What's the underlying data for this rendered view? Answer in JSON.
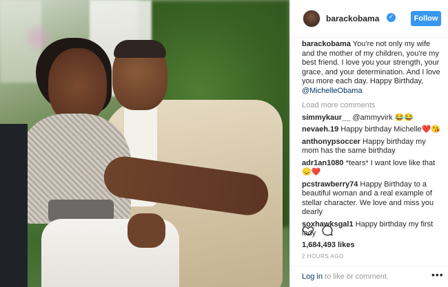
{
  "post": {
    "username": "barackobama",
    "follow_label": "Follow",
    "verified_glyph": "✓",
    "caption_user": "barackobama",
    "caption_text": " You're not only my wife and the mother of my children, you're my best friend. I love you your strength, your grace, and your determination. And I love you more each day. Happy Birthday, ",
    "caption_mention": "@MichelleObama",
    "load_more": "Load more comments",
    "comments": [
      {
        "user": "simmykaur__",
        "text": " @ammyvirk 😂😂"
      },
      {
        "user": "nevaeh.19",
        "text": " Happy birthday Michelle❤️😘"
      },
      {
        "user": "anthonypsoccer",
        "text": " Happy birthday my mom has the same birthday"
      },
      {
        "user": "adr1an1080",
        "text": " *tears* I want love like that😞❤️"
      },
      {
        "user": "pcstrawberry74",
        "text": " Happy Birthday to a beautiful woman and a real example of stellar character. We love and miss you dearly"
      },
      {
        "user": "soxhawksgal1",
        "text": " Happy birthday my first lady"
      }
    ],
    "likes": "1,684,493 likes",
    "time_ago": "2 HOURS AGO",
    "login_link": "Log in",
    "login_text": " to like or comment.",
    "more_glyph": "•••"
  },
  "icons": {
    "heart": "heart-icon",
    "comment": "comment-icon",
    "verified": "verified-badge-icon",
    "more": "more-options-icon"
  },
  "colors": {
    "accent": "#3897f0",
    "link": "#003569",
    "muted": "#999999",
    "text": "#262626"
  }
}
